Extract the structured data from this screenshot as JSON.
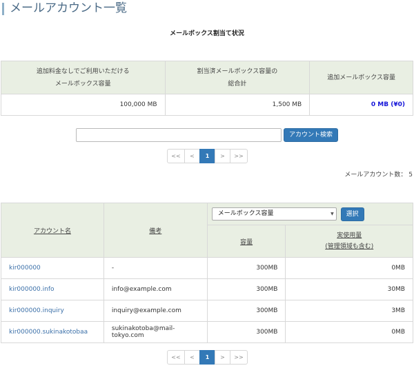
{
  "page": {
    "title": "メールアカウント一覧"
  },
  "quota": {
    "heading": "メールボックス割当て状況",
    "headers": [
      "追加料金なしでご利用いただける\nメールボックス容量",
      "割当済メールボックス容量の\n総合計",
      "追加メールボックス容量"
    ],
    "values": [
      "100,000 MB",
      "1,500 MB",
      "0 MB (¥0)"
    ]
  },
  "search": {
    "placeholder": "",
    "value": "",
    "button_label": "アカウント検索"
  },
  "pagination": {
    "first": "<<",
    "prev": "<",
    "current": "1",
    "next": ">",
    "last": ">>"
  },
  "account_count": "メールアカウント数： 5",
  "accounts": {
    "col_account": "アカウント名",
    "col_note": "備考",
    "col_capacity": "容量",
    "col_usage_line1": "実使用量",
    "col_usage_line2": "(管理領域も含む)",
    "select_value": "メールボックス容量",
    "select_button": "選択",
    "rows": [
      {
        "name": "kir000000",
        "note": "-",
        "capacity": "300MB",
        "usage": "0MB"
      },
      {
        "name": "kir000000.info",
        "note": "info@example.com",
        "capacity": "300MB",
        "usage": "30MB"
      },
      {
        "name": "kir000000.inquiry",
        "note": "inquiry@example.com",
        "capacity": "300MB",
        "usage": "3MB"
      },
      {
        "name": "kir000000.sukinakotobaa",
        "note": "sukinakotoba@mail-tokyo.com",
        "capacity": "300MB",
        "usage": "0MB"
      }
    ]
  },
  "colors": {
    "accent": "#3379b7",
    "header_bg": "#e9efe3",
    "link": "#3a6fa8",
    "highlight": "#1414d8"
  }
}
